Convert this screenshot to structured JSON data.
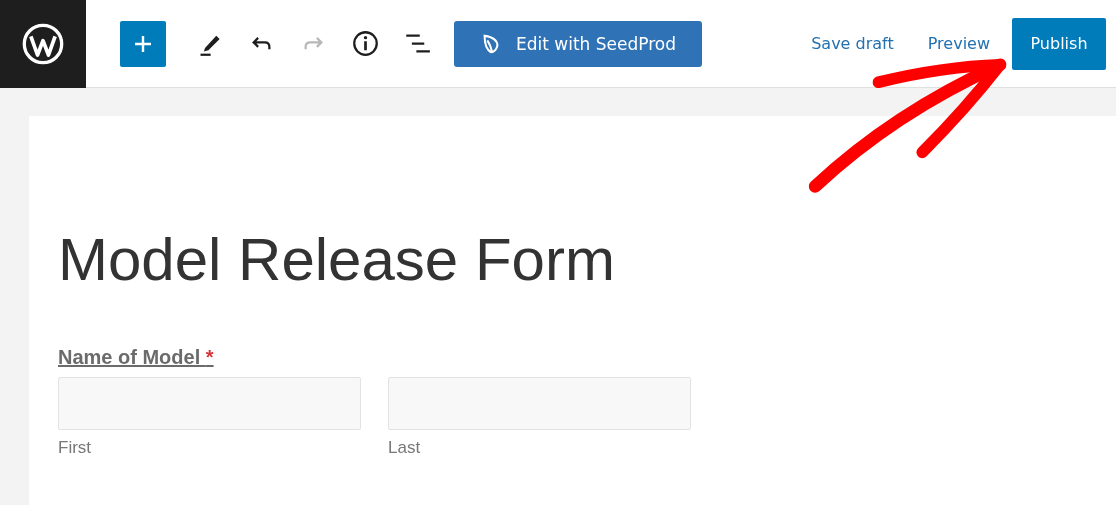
{
  "toolbar": {
    "history_buttons": [
      {
        "kind": "undo",
        "disabled": false
      },
      {
        "kind": "redo",
        "disabled": true
      }
    ],
    "seedprod_button": "Edit with SeedProd",
    "save_draft": "Save draft",
    "preview": "Preview",
    "publish": "Publish"
  },
  "editor": {
    "title": "Model Release Form",
    "field": {
      "label": "Name of Model",
      "required_mark": "*",
      "inputs": [
        {
          "sublabel": "First"
        },
        {
          "sublabel": "Last"
        }
      ]
    }
  }
}
